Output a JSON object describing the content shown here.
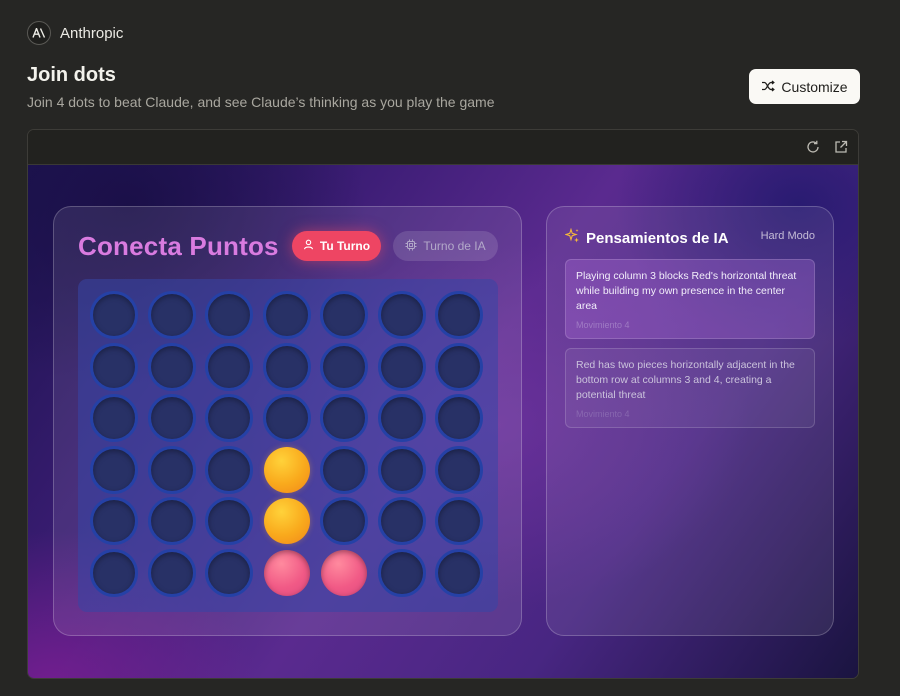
{
  "brand": {
    "name": "Anthropic",
    "logo_text": "A\\"
  },
  "page": {
    "title": "Join dots",
    "subtitle": "Join 4 dots to beat Claude, and see Claude’s thinking as you play the game"
  },
  "toolbar": {
    "customize_label": "Customize",
    "refresh_icon": "refresh-icon",
    "open_external_icon": "external-link-icon"
  },
  "game": {
    "title": "Conecta Puntos",
    "your_turn_label": "Tu Turno",
    "ai_turn_label": "Turno de IA",
    "rows": 6,
    "columns": 7,
    "board": [
      [
        "empty",
        "empty",
        "empty",
        "empty",
        "empty",
        "empty",
        "empty"
      ],
      [
        "empty",
        "empty",
        "empty",
        "empty",
        "empty",
        "empty",
        "empty"
      ],
      [
        "empty",
        "empty",
        "empty",
        "empty",
        "empty",
        "empty",
        "empty"
      ],
      [
        "empty",
        "empty",
        "empty",
        "yellow",
        "empty",
        "empty",
        "empty"
      ],
      [
        "empty",
        "empty",
        "empty",
        "yellow",
        "empty",
        "empty",
        "empty"
      ],
      [
        "empty",
        "empty",
        "empty",
        "red",
        "red",
        "empty",
        "empty"
      ]
    ]
  },
  "thoughts": {
    "title": "Pensamientos de IA",
    "mode": "Hard Modo",
    "items": [
      {
        "text": "Playing column 3 blocks Red's horizontal threat while building my own presence in the center area",
        "move": "Movimiento 4"
      },
      {
        "text": "Red has two pieces horizontally adjacent in the bottom row at columns 3 and 4, creating a potential threat",
        "move": "Movimiento 4"
      }
    ]
  },
  "colors": {
    "accent_red": "#ee4563",
    "title_pink": "#d97be0",
    "yellow_piece": "#f9a91c",
    "red_piece": "#f15a86",
    "board_blue": "#2541a6"
  }
}
